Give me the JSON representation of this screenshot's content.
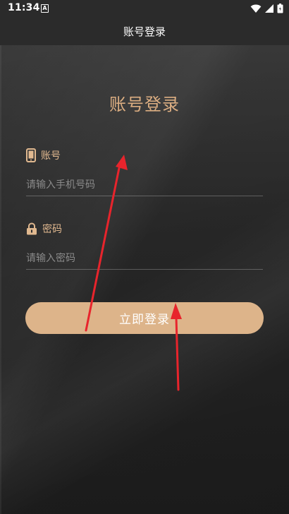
{
  "status_bar": {
    "time": "11:34",
    "notification_icon": "notification-a-icon",
    "wifi_icon": "wifi-icon",
    "signal_icon": "signal-icon",
    "battery_icon": "battery-icon"
  },
  "header": {
    "title": "账号登录"
  },
  "form": {
    "title": "账号登录",
    "account": {
      "icon": "phone-icon",
      "label": "账号",
      "placeholder": "请输入手机号码",
      "value": ""
    },
    "password": {
      "icon": "lock-icon",
      "label": "密码",
      "placeholder": "请输入密码",
      "value": ""
    },
    "submit_label": "立即登录"
  },
  "colors": {
    "accent": "#ddb48a",
    "label": "#e0b88f",
    "title": "#dcae82",
    "annotation_arrow": "#e8242c"
  }
}
